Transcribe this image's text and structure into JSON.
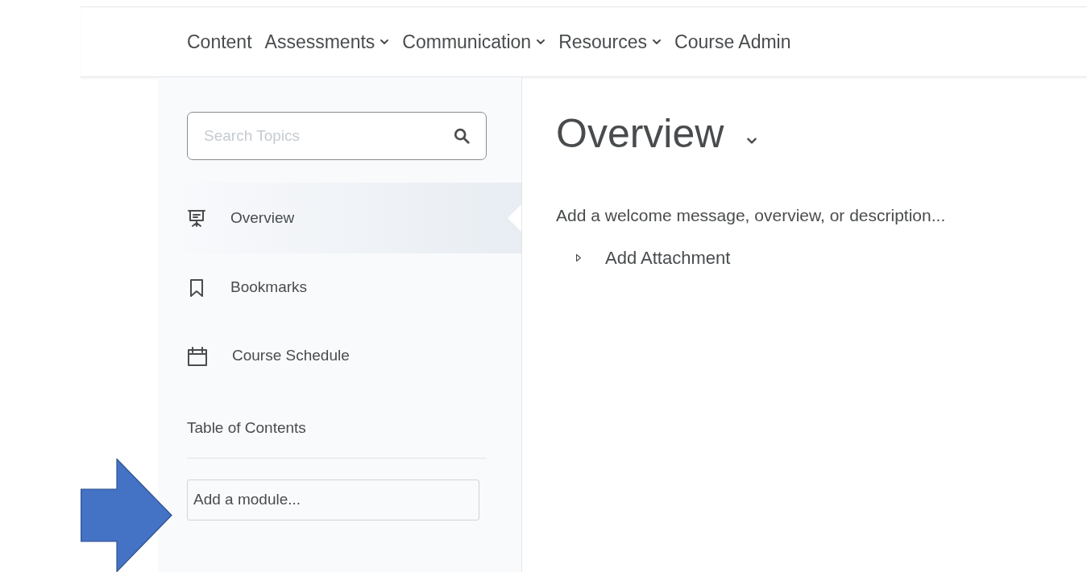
{
  "nav": [
    {
      "label": "Content",
      "has_menu": false
    },
    {
      "label": "Assessments",
      "has_menu": true
    },
    {
      "label": "Communication",
      "has_menu": true
    },
    {
      "label": "Resources",
      "has_menu": true
    },
    {
      "label": "Course Admin",
      "has_menu": false
    }
  ],
  "sidebar": {
    "search": {
      "placeholder": "Search Topics"
    },
    "items": [
      {
        "label": "Overview",
        "kind": "presentation",
        "selected": true
      },
      {
        "label": "Bookmarks",
        "kind": "bookmark",
        "selected": false
      },
      {
        "label": "Course Schedule",
        "kind": "calendar",
        "selected": false
      }
    ],
    "toc_heading": "Table of Contents",
    "module_field": {
      "placeholder": "Add a module..."
    }
  },
  "main": {
    "title": "Overview",
    "description": "Add a welcome message, overview, or description...",
    "attachment": "Add Attachment"
  }
}
